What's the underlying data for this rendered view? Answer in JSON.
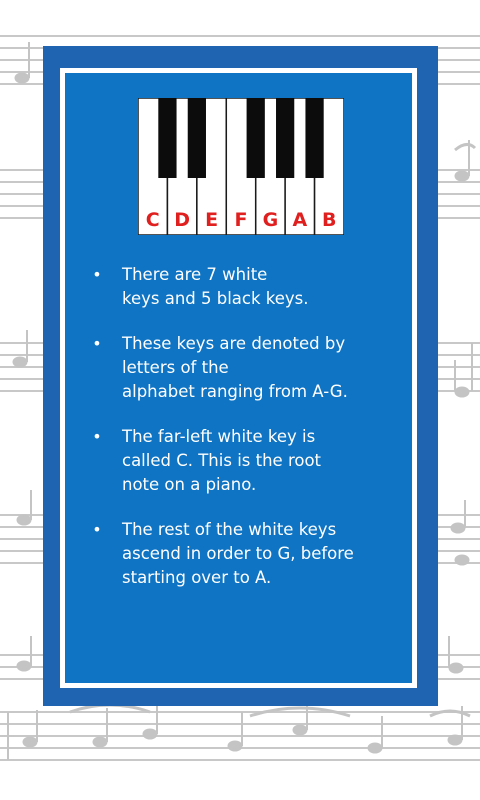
{
  "keyboard": {
    "white_keys": [
      "C",
      "D",
      "E",
      "F",
      "G",
      "A",
      "B"
    ],
    "black_key_count": 5,
    "label_color": "#e01f1f"
  },
  "card": {
    "outer_color": "#1f64b0",
    "inner_color": "#0f74c4"
  },
  "facts": [
    {
      "lines": [
        "There  are 7 white",
        "keys and 5 black keys."
      ]
    },
    {
      "lines": [
        "These keys are denoted by",
        "letters of the",
        "alphabet ranging from A-G."
      ]
    },
    {
      "lines": [
        "The far-left white key is",
        "called C. This is the root",
        "note on a piano."
      ]
    },
    {
      "lines": [
        "The rest of the white keys",
        "ascend in order to G, before",
        "starting over to A."
      ]
    }
  ],
  "bullet_symbol": "•"
}
